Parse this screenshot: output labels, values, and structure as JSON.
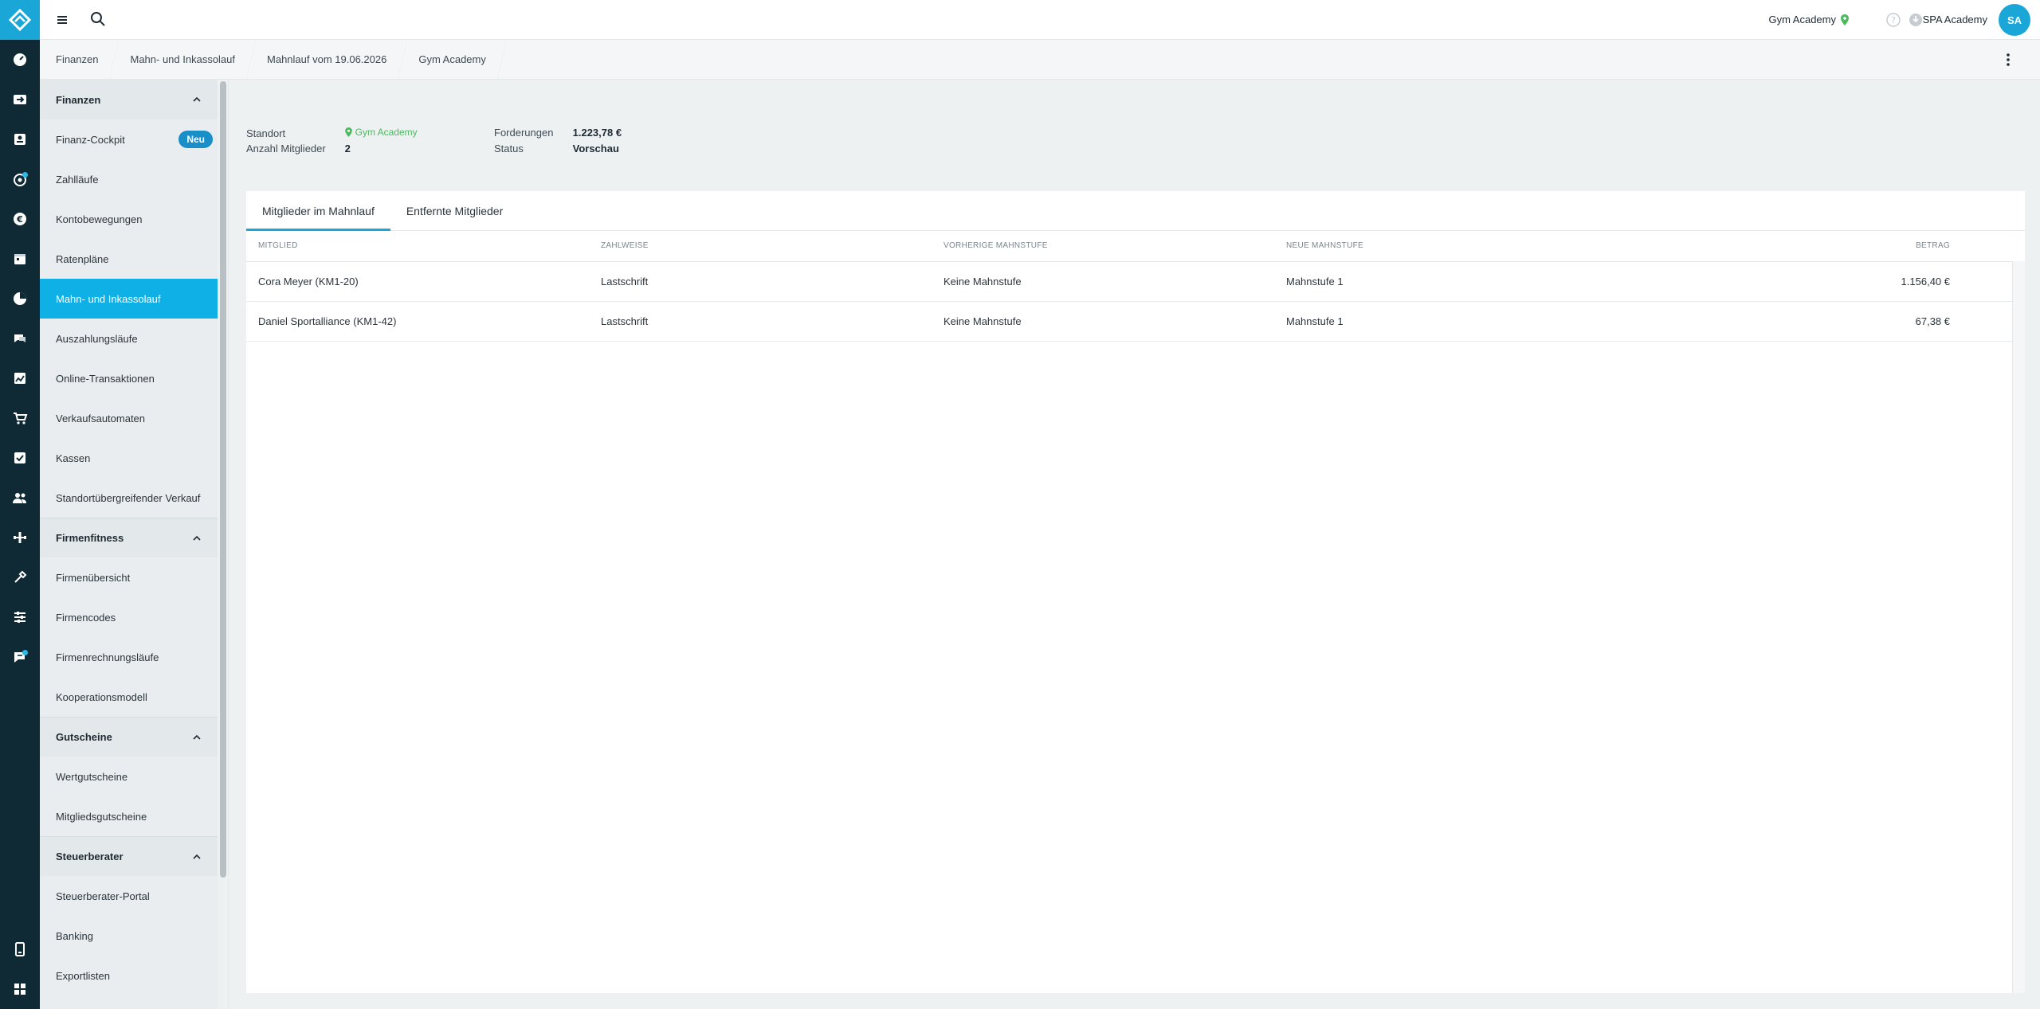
{
  "topbar": {
    "studio_name": "Gym Academy",
    "user_name": "SPA Academy",
    "avatar_initials": "SA"
  },
  "breadcrumb": [
    "Finanzen",
    "Mahn- und Inkassolauf",
    "Mahnlauf vom 19.06.2026",
    "Gym Academy"
  ],
  "sidebar": {
    "sections": [
      {
        "title": "Finanzen",
        "items": [
          {
            "label": "Finanz-Cockpit",
            "badge": "Neu"
          },
          {
            "label": "Zahlläufe"
          },
          {
            "label": "Kontobewegungen"
          },
          {
            "label": "Ratenpläne"
          },
          {
            "label": "Mahn- und Inkassolauf",
            "active": true
          },
          {
            "label": "Auszahlungsläufe"
          },
          {
            "label": "Online-Transaktionen"
          },
          {
            "label": "Verkaufsautomaten"
          },
          {
            "label": "Kassen"
          },
          {
            "label": "Standortübergreifender Verkauf"
          }
        ]
      },
      {
        "title": "Firmenfitness",
        "items": [
          {
            "label": "Firmenübersicht"
          },
          {
            "label": "Firmencodes"
          },
          {
            "label": "Firmenrechnungsläufe"
          },
          {
            "label": "Kooperationsmodell"
          }
        ]
      },
      {
        "title": "Gutscheine",
        "items": [
          {
            "label": "Wertgutscheine"
          },
          {
            "label": "Mitgliedsgutscheine"
          }
        ]
      },
      {
        "title": "Steuerberater",
        "items": [
          {
            "label": "Steuerberater-Portal"
          },
          {
            "label": "Banking"
          },
          {
            "label": "Exportlisten"
          }
        ]
      }
    ]
  },
  "meta": {
    "standort_label": "Standort",
    "standort_value": "Gym Academy",
    "mitglieder_label": "Anzahl Mitglieder",
    "mitglieder_value": "2",
    "forderungen_label": "Forderungen",
    "forderungen_value": "1.223,78 €",
    "status_label": "Status",
    "status_value": "Vorschau"
  },
  "tabs": [
    "Mitglieder im Mahnlauf",
    "Entfernte Mitglieder"
  ],
  "table": {
    "headers": [
      "Mitglied",
      "Zahlweise",
      "Vorherige Mahnstufe",
      "Neue Mahnstufe",
      "Betrag"
    ],
    "rows": [
      [
        "Cora Meyer (KM1-20)",
        "Lastschrift",
        "Keine Mahnstufe",
        "Mahnstufe 1",
        "1.156,40 €"
      ],
      [
        "Daniel Sportalliance (KM1-42)",
        "Lastschrift",
        "Keine Mahnstufe",
        "Mahnstufe 1",
        "67,38 €"
      ]
    ]
  },
  "colors": {
    "accent": "#1aa7d8",
    "rail": "#0f2a35",
    "active_nav": "#0fb0e6",
    "location_green": "#4cb95f"
  }
}
